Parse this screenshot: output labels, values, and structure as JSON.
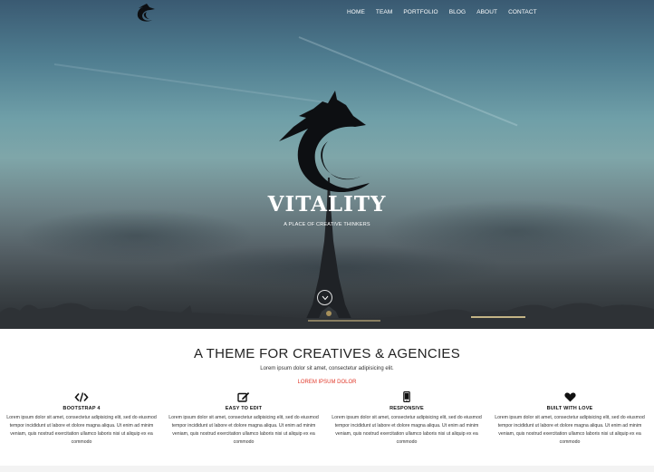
{
  "nav": {
    "items": [
      "HOME",
      "TEAM",
      "PORTFOLIO",
      "BLOG",
      "ABOUT",
      "CONTACT"
    ]
  },
  "hero": {
    "brand": "VITALITY",
    "tagline": "A PLACE OF CREATIVE THINKERS",
    "icons": {
      "logo": "eagle-logo-icon",
      "scroll": "chevron-down-icon"
    }
  },
  "intro": {
    "title": "A THEME FOR CREATIVES & AGENCIES",
    "subtitle": "Lorem ipsum dolor sit amet, consectetur adipisicing elit.",
    "link": "LOREM IPSUM DOLOR"
  },
  "features": [
    {
      "icon": "code-icon",
      "title": "BOOTSTRAP 4",
      "text": "Lorem ipsum dolor sit amet, consectetur adipisicing elit, sed do eiusmod tempor incididunt ut labore et dolore magna aliqua. Ut enim ad minim veniam, quis nostrud exercitation ullamco laboris nisi ut aliquip ex ea commodo"
    },
    {
      "icon": "edit-icon",
      "title": "EASY TO EDIT",
      "text": "Lorem ipsum dolor sit amet, consectetur adipisicing elit, sed do eiusmod tempor incididunt ut labore et dolore magna aliqua. Ut enim ad minim veniam, quis nostrud exercitation ullamco laboris nisi ut aliquip ex ea commodo"
    },
    {
      "icon": "mobile-icon",
      "title": "RESPONSIVE",
      "text": "Lorem ipsum dolor sit amet, consectetur adipisicing elit, sed do eiusmod tempor incididunt ut labore et dolore magna aliqua. Ut enim ad minim veniam, quis nostrud exercitation ullamco laboris nisi ut aliquip ex ea commodo"
    },
    {
      "icon": "heart-icon",
      "title": "BUILT WITH LOVE",
      "text": "Lorem ipsum dolor sit amet, consectetur adipisicing elit, sed do eiusmod tempor incididunt ut labore et dolore magna aliqua. Ut enim ad minim veniam, quis nostrud exercitation ullamco laboris nisi ut aliquip ex ea commodo"
    }
  ],
  "colors": {
    "accent": "#e0392b",
    "text": "#222222"
  }
}
